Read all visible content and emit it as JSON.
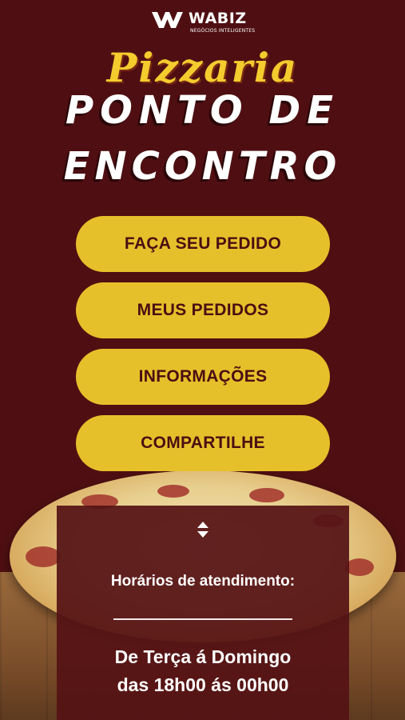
{
  "brand": {
    "name": "WABIZ",
    "tagline": "NEGÓCIOS INTELIGENTES",
    "logo_icon": "wabiz-logo-icon"
  },
  "header": {
    "script_title": "Pizzaria",
    "title_line_1": "PONTO DE",
    "title_line_2": "ENCONTRO"
  },
  "menu": {
    "items": [
      {
        "label": "FAÇA SEU PEDIDO"
      },
      {
        "label": "MEUS PEDIDOS"
      },
      {
        "label": "INFORMAÇÕES"
      },
      {
        "label": "COMPARTILHE"
      }
    ]
  },
  "info": {
    "toggle_icon": "expand-collapse-icon",
    "hours_title": "Horários de atendimento:",
    "days": "De Terça á Domingo",
    "time": "das 18h00 ás 00h00"
  },
  "colors": {
    "background": "#4f0f12",
    "button": "#e6c02a",
    "button_text": "#4a0f12",
    "script_title": "#f4cc2e",
    "panel": "#551214"
  }
}
